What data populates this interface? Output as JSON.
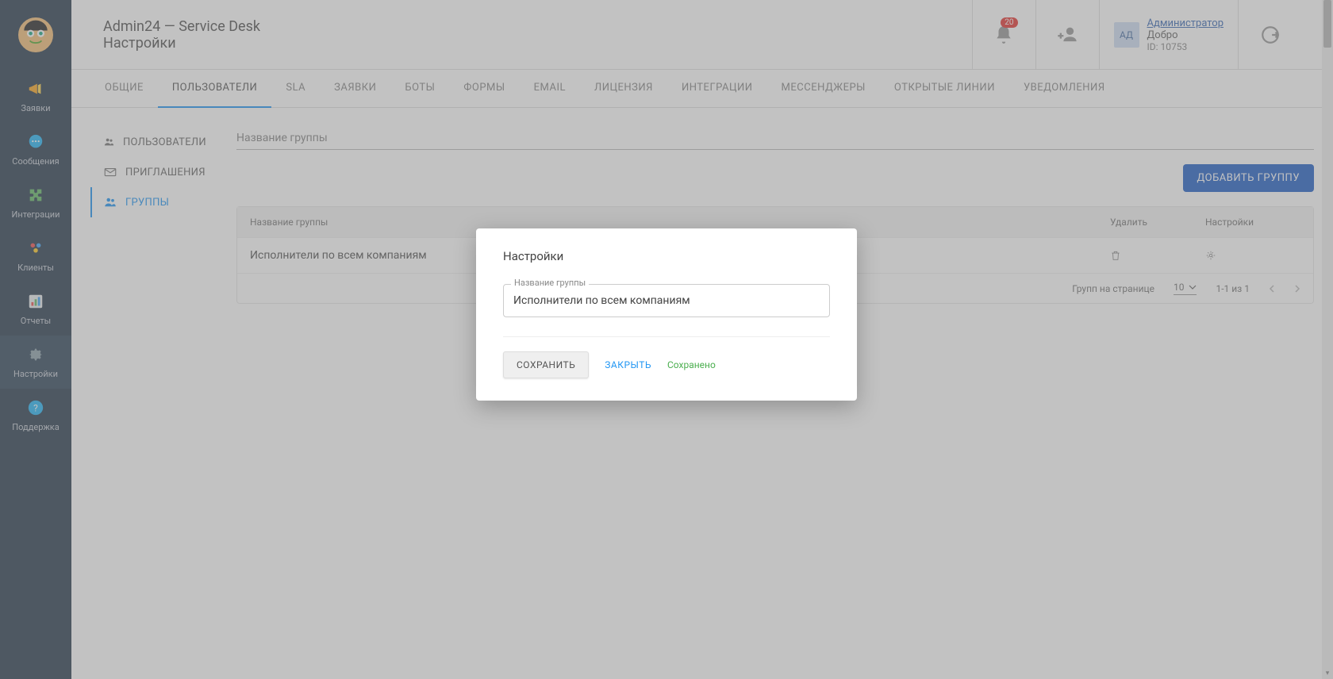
{
  "header": {
    "title": "Admin24 — Service Desk",
    "subtitle": "Настройки",
    "notif_count": "20",
    "user": {
      "initials": "АД",
      "name": "Администратор",
      "greeting": "Добро",
      "id": "ID: 10753"
    }
  },
  "sidebar": {
    "items": [
      {
        "label": "Заявки"
      },
      {
        "label": "Сообщения"
      },
      {
        "label": "Интеграции"
      },
      {
        "label": "Клиенты"
      },
      {
        "label": "Отчеты"
      },
      {
        "label": "Настройки"
      },
      {
        "label": "Поддержка"
      }
    ]
  },
  "tabs": [
    "ОБЩИЕ",
    "ПОЛЬЗОВАТЕЛИ",
    "SLA",
    "ЗАЯВКИ",
    "БОТЫ",
    "ФОРМЫ",
    "EMAIL",
    "ЛИЦЕНЗИЯ",
    "ИНТЕГРАЦИИ",
    "МЕССЕНДЖЕРЫ",
    "ОТКРЫТЫЕ ЛИНИИ",
    "УВЕДОМЛЕНИЯ"
  ],
  "subnav": [
    "ПОЛЬЗОВАТЕЛИ",
    "ПРИГЛАШЕНИЯ",
    "ГРУППЫ"
  ],
  "search": {
    "placeholder": "Название группы"
  },
  "buttons": {
    "add_group": "ДОБАВИТЬ ГРУППУ"
  },
  "table": {
    "cols": {
      "name": "Название группы",
      "delete": "Удалить",
      "settings": "Настройки"
    },
    "rows": [
      {
        "name": "Исполнители по всем компаниям"
      }
    ],
    "footer": {
      "per_page_label": "Групп на странице",
      "per_page_value": "10",
      "range": "1-1 из 1"
    }
  },
  "modal": {
    "title": "Настройки",
    "field_label": "Название группы",
    "field_value": "Исполнители по всем компаниям",
    "save": "СОХРАНИТЬ",
    "close": "ЗАКРЫТЬ",
    "saved": "Сохранено"
  }
}
